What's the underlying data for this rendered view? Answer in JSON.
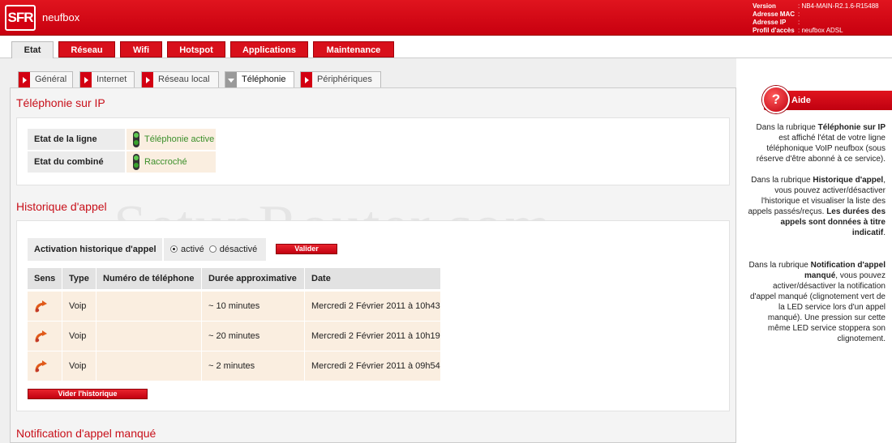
{
  "header": {
    "logo": "SFR",
    "brand": "neufbox",
    "info": [
      {
        "key": "Version",
        "value": ": NB4-MAIN-R2.1.6-R15488"
      },
      {
        "key": "Adresse MAC",
        "value": ":"
      },
      {
        "key": "Adresse IP",
        "value": ":"
      },
      {
        "key": "Profil d'accès",
        "value": ": neufbox ADSL"
      }
    ]
  },
  "main_tabs": [
    "Etat",
    "Réseau",
    "Wifi",
    "Hotspot",
    "Applications",
    "Maintenance"
  ],
  "sub_tabs": [
    "Général",
    "Internet",
    "Réseau local",
    "Téléphonie",
    "Périphériques"
  ],
  "voip": {
    "title": "Téléphonie sur IP",
    "rows": [
      {
        "label": "Etat de la ligne",
        "value": "Téléphonie active",
        "led": "green"
      },
      {
        "label": "Etat du combiné",
        "value": "Raccroché",
        "led": "green"
      }
    ]
  },
  "history": {
    "title": "Historique d'appel",
    "activation_label": "Activation historique d'appel",
    "option_on": "activé",
    "option_off": "désactivé",
    "selected": "activé",
    "validate_label": "Valider",
    "columns": [
      "Sens",
      "Type",
      "Numéro de téléphone",
      "Durée approximative",
      "Date"
    ],
    "rows": [
      {
        "direction_icon": "outgoing-call-icon",
        "type": "Voip",
        "number": "",
        "duration": "~ 10 minutes",
        "date": "Mercredi 2 Février 2011 à 10h43"
      },
      {
        "direction_icon": "outgoing-call-icon",
        "type": "Voip",
        "number": "",
        "duration": "~ 20 minutes",
        "date": "Mercredi 2 Février 2011 à 10h19"
      },
      {
        "direction_icon": "outgoing-call-icon",
        "type": "Voip",
        "number": "",
        "duration": "~ 2 minutes",
        "date": "Mercredi 2 Février 2011 à 09h54"
      }
    ],
    "clear_label": "Vider l'historique"
  },
  "missed": {
    "title": "Notification d'appel manqué"
  },
  "help": {
    "title": "Aide",
    "p1_a": "Dans la rubrique ",
    "p1_b": "Téléphonie sur IP",
    "p1_c": " est affiché l'état de votre ligne téléphonique VoIP neufbox (sous réserve d'être abonné à ce service).",
    "p2_a": "Dans la rubrique ",
    "p2_b": "Historique d'appel",
    "p2_c": ", vous pouvez activer/désactiver l'historique et visualiser la liste des appels passés/reçus. ",
    "p2_d": "Les durées des appels sont données à titre indicatif",
    "p2_e": ".",
    "p3_a": "Dans la rubrique ",
    "p3_b": "Notification d'appel manqué",
    "p3_c": ", vous pouvez activer/désactiver la notification d'appel manqué (clignotement vert de la LED service lors d'un appel manqué). Une pression sur cette même LED service stoppera son clignotement."
  },
  "watermark": "SetupRouter.com",
  "colors": {
    "brand_red": "#d30012",
    "value_green": "#3b8f2a",
    "value_bg": "#faeee0"
  }
}
